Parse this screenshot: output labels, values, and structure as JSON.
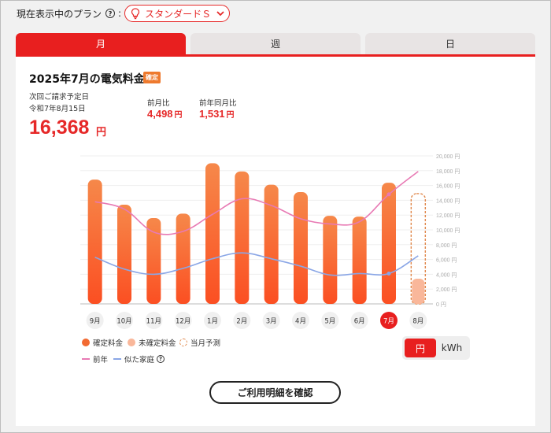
{
  "plan": {
    "label": "現在表示中のプラン",
    "help": "?",
    "colon": ":",
    "name": "スタンダードＳ"
  },
  "tabs": [
    {
      "label": "月",
      "active": true
    },
    {
      "label": "週",
      "active": false
    },
    {
      "label": "日",
      "active": false
    }
  ],
  "summary": {
    "title": "2025年7月の電気料金",
    "badge": "確定",
    "next_billing_label": "次回ご請求予定日",
    "next_billing_date": "令和7年8月15日",
    "amount": "16,368",
    "amount_unit": "円",
    "mom_label": "前月比",
    "mom_value": "4,498",
    "yoy_label": "前年同月比",
    "yoy_value": "1,531",
    "unit": "円"
  },
  "chart_data": {
    "type": "bar",
    "categories": [
      "9月",
      "10月",
      "11月",
      "12月",
      "1月",
      "2月",
      "3月",
      "4月",
      "5月",
      "6月",
      "7月",
      "8月"
    ],
    "selected_category": "7月",
    "y_ticks": [
      "0 円",
      "2,000 円",
      "4,000 円",
      "6,000 円",
      "8,000 円",
      "10,000 円",
      "12,000 円",
      "14,000 円",
      "16,000 円",
      "18,000 円",
      "20,000 円"
    ],
    "ylim": [
      0,
      20000
    ],
    "series": [
      {
        "name": "確定料金",
        "kind": "bar",
        "color": "#f26a32",
        "values": [
          16800,
          13400,
          11600,
          12200,
          19000,
          17900,
          16100,
          15100,
          11900,
          11800,
          16368,
          null
        ]
      },
      {
        "name": "未確定料金",
        "kind": "bar",
        "color": "#f9b79a",
        "values": [
          null,
          null,
          null,
          null,
          null,
          null,
          null,
          null,
          null,
          null,
          null,
          3400
        ]
      },
      {
        "name": "当月予測",
        "kind": "bar-dashed",
        "color": "#e0874a",
        "values": [
          null,
          null,
          null,
          null,
          null,
          null,
          null,
          null,
          null,
          null,
          null,
          14900
        ]
      },
      {
        "name": "前年",
        "kind": "line",
        "color": "#e87ab4",
        "values": [
          13800,
          12800,
          9700,
          9800,
          12100,
          14200,
          13300,
          11500,
          10800,
          11100,
          14800,
          17900
        ]
      },
      {
        "name": "似た家庭",
        "kind": "line",
        "color": "#8aa6e6",
        "values": [
          6300,
          4700,
          4000,
          4800,
          6100,
          6900,
          6100,
          5100,
          3900,
          4100,
          4100,
          6500
        ]
      }
    ]
  },
  "legend": {
    "confirmed": "確定料金",
    "unconfirmed": "未確定料金",
    "forecast": "当月予測",
    "prev_year": "前年",
    "similar": "似た家庭",
    "help": "?"
  },
  "unit_toggle": {
    "yen": "円",
    "kwh": "kWh",
    "selected": "円"
  },
  "detail_button": "ご利用明細を確認",
  "colors": {
    "accent": "#e81f1f",
    "bar": "#f26a32",
    "bar_light": "#f9b79a"
  }
}
